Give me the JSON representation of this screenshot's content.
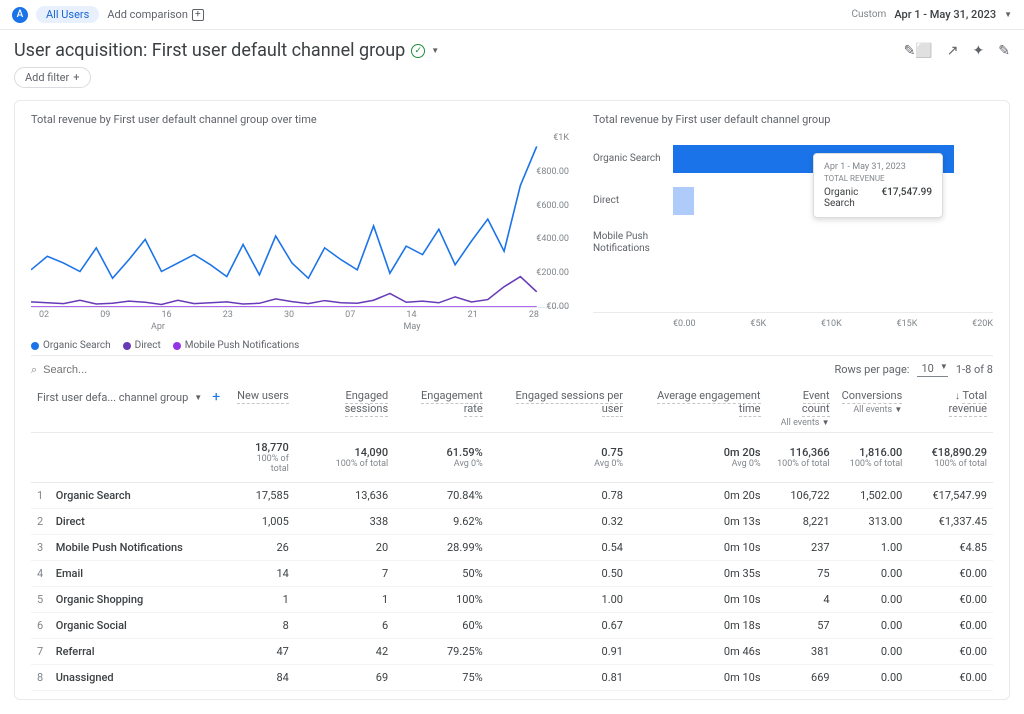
{
  "topbar": {
    "badge": "A",
    "all_users": "All Users",
    "add_comparison": "Add comparison",
    "custom_label": "Custom",
    "date_range": "Apr 1 - May 31, 2023"
  },
  "title": {
    "text": "User acquisition: First user default channel group"
  },
  "filter": {
    "add_filter": "Add filter"
  },
  "line_chart": {
    "title": "Total revenue by First user default channel group over time",
    "legend": [
      "Organic Search",
      "Direct",
      "Mobile Push Notifications"
    ],
    "month_left": "Apr",
    "month_right": "May"
  },
  "bar_chart": {
    "title": "Total revenue by First user default channel group",
    "rows": [
      "Organic Search",
      "Direct",
      "Mobile Push Notifications"
    ]
  },
  "tooltip": {
    "date": "Apr 1 - May 31, 2023",
    "metric": "TOTAL REVENUE",
    "label": "Organic Search",
    "value": "€17,547.99"
  },
  "tablebar": {
    "search_placeholder": "Search...",
    "rows_per_page": "Rows per page:",
    "rpp_value": "10",
    "range": "1-8 of 8"
  },
  "columns": {
    "dim": "First user defa... channel group",
    "c1": "New users",
    "c2": "Engaged sessions",
    "c3": "Engagement rate",
    "c4": "Engaged sessions per user",
    "c5": "Average engagement time",
    "c6": "Event count",
    "c6s": "All events",
    "c7": "Conversions",
    "c7s": "All events",
    "c8": "Total revenue"
  },
  "totals": {
    "c1": "18,770",
    "c1s": "100% of total",
    "c2": "14,090",
    "c2s": "100% of total",
    "c3": "61.59%",
    "c3s": "Avg 0%",
    "c4": "0.75",
    "c4s": "Avg 0%",
    "c5": "0m 20s",
    "c5s": "Avg 0%",
    "c6": "116,366",
    "c6s": "100% of total",
    "c7": "1,816.00",
    "c7s": "100% of total",
    "c8": "€18,890.29",
    "c8s": "100% of total"
  },
  "rows": [
    {
      "n": "1",
      "name": "Organic Search",
      "c1": "17,585",
      "c2": "13,636",
      "c3": "70.84%",
      "c4": "0.78",
      "c5": "0m 20s",
      "c6": "106,722",
      "c7": "1,502.00",
      "c8": "€17,547.99"
    },
    {
      "n": "2",
      "name": "Direct",
      "c1": "1,005",
      "c2": "338",
      "c3": "9.62%",
      "c4": "0.32",
      "c5": "0m 13s",
      "c6": "8,221",
      "c7": "313.00",
      "c8": "€1,337.45"
    },
    {
      "n": "3",
      "name": "Mobile Push Notifications",
      "c1": "26",
      "c2": "20",
      "c3": "28.99%",
      "c4": "0.54",
      "c5": "0m 10s",
      "c6": "237",
      "c7": "1.00",
      "c8": "€4.85"
    },
    {
      "n": "4",
      "name": "Email",
      "c1": "14",
      "c2": "7",
      "c3": "50%",
      "c4": "0.50",
      "c5": "0m 35s",
      "c6": "75",
      "c7": "0.00",
      "c8": "€0.00"
    },
    {
      "n": "5",
      "name": "Organic Shopping",
      "c1": "1",
      "c2": "1",
      "c3": "100%",
      "c4": "1.00",
      "c5": "0m 10s",
      "c6": "4",
      "c7": "0.00",
      "c8": "€0.00"
    },
    {
      "n": "6",
      "name": "Organic Social",
      "c1": "8",
      "c2": "6",
      "c3": "60%",
      "c4": "0.67",
      "c5": "0m 18s",
      "c6": "57",
      "c7": "0.00",
      "c8": "€0.00"
    },
    {
      "n": "7",
      "name": "Referral",
      "c1": "47",
      "c2": "42",
      "c3": "79.25%",
      "c4": "0.91",
      "c5": "0m 46s",
      "c6": "381",
      "c7": "0.00",
      "c8": "€0.00"
    },
    {
      "n": "8",
      "name": "Unassigned",
      "c1": "84",
      "c2": "69",
      "c3": "75%",
      "c4": "0.81",
      "c5": "0m 10s",
      "c6": "669",
      "c7": "0.00",
      "c8": "€0.00"
    }
  ],
  "chart_data": {
    "line": {
      "type": "line",
      "title": "Total revenue by First user default channel group over time",
      "xlabel": "",
      "ylabel": "",
      "ylim": [
        0,
        1000
      ],
      "yticks": [
        "€0.00",
        "€200.00",
        "€400.00",
        "€600.00",
        "€800.00",
        "€1K"
      ],
      "x": [
        "02",
        "09",
        "16",
        "23",
        "30",
        "07",
        "14",
        "21",
        "28"
      ],
      "series": [
        {
          "name": "Organic Search",
          "color": "#1a73e8",
          "values": [
            220,
            300,
            260,
            210,
            350,
            170,
            280,
            400,
            210,
            260,
            310,
            250,
            180,
            370,
            190,
            420,
            260,
            170,
            350,
            280,
            220,
            480,
            200,
            360,
            310,
            460,
            250,
            390,
            520,
            330,
            720,
            950
          ]
        },
        {
          "name": "Direct",
          "color": "#673ab7",
          "values": [
            30,
            25,
            20,
            40,
            18,
            22,
            35,
            28,
            15,
            40,
            20,
            25,
            30,
            18,
            22,
            48,
            32,
            20,
            38,
            25,
            22,
            40,
            80,
            28,
            35,
            25,
            60,
            30,
            44,
            120,
            180,
            90
          ]
        },
        {
          "name": "Mobile Push Notifications",
          "color": "#9334e6",
          "values": [
            0,
            0,
            0,
            0,
            0,
            0,
            0,
            0,
            0,
            0,
            0,
            0,
            0,
            0,
            0,
            0,
            0,
            0,
            0,
            0,
            0,
            0,
            0,
            0,
            0,
            0,
            0,
            0,
            0,
            0,
            0,
            0
          ]
        }
      ]
    },
    "bar": {
      "type": "bar",
      "title": "Total revenue by First user default channel group",
      "categories": [
        "Organic Search",
        "Direct",
        "Mobile Push Notifications"
      ],
      "values": [
        17547.99,
        1337.45,
        4.85
      ],
      "xlim": [
        0,
        20000
      ],
      "xticks": [
        "€0.00",
        "€5K",
        "€10K",
        "€15K",
        "€20K"
      ]
    }
  }
}
